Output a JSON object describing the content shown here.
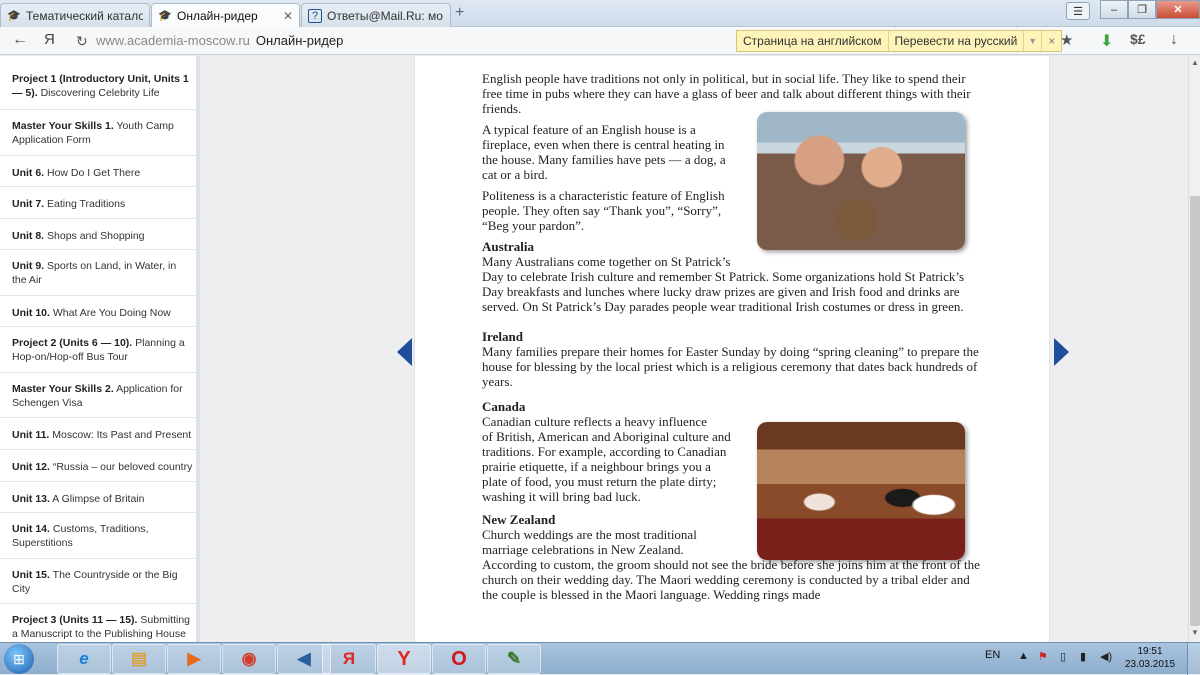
{
  "tabs": [
    {
      "title": "Тематический катало",
      "icon": "graduation-cap-icon",
      "active": false
    },
    {
      "title": "Онлайн-ридер",
      "icon": "graduation-cap-icon",
      "active": true
    },
    {
      "title": "Ответы@Mail.Ru: мо",
      "icon": "question-icon",
      "active": false
    }
  ],
  "address": {
    "back_icon": "←",
    "yandex_logo": "Я",
    "reload_icon": "↻",
    "domain": "www.academia-moscow.ru",
    "page_title": "Онлайн-ридер"
  },
  "translate": {
    "source": "Страница на английском",
    "action": "Перевести на русский",
    "close": "×"
  },
  "toolbar_right": {
    "star": "★",
    "download": "⬇",
    "currency": "$£",
    "save": "↓"
  },
  "sidebar": {
    "items": [
      {
        "unit": "Project 1 (Introductory Unit, Units 1 — 5).",
        "title": " Discovering Celebrity Life"
      },
      {
        "unit": "Master Your Skills 1.",
        "title": " Youth Camp Application Form"
      },
      {
        "unit": "Unit 6.",
        "title": " How Do I Get There"
      },
      {
        "unit": "Unit 7.",
        "title": " Eating Traditions"
      },
      {
        "unit": "Unit 8.",
        "title": " Shops and Shopping"
      },
      {
        "unit": "Unit 9.",
        "title": " Sports on Land, in Water, in the Air"
      },
      {
        "unit": "Unit 10.",
        "title": " What Are You Doing Now"
      },
      {
        "unit": "Project 2 (Units 6 — 10).",
        "title": " Planning a Hop-on/Hop-off Bus Tour"
      },
      {
        "unit": "Master Your Skills 2.",
        "title": " Application for Schengen Visa"
      },
      {
        "unit": "Unit 11.",
        "title": " Moscow: Its Past and Present"
      },
      {
        "unit": "Unit 12.",
        "title": " “Russia – our beloved country"
      },
      {
        "unit": "Unit 13.",
        "title": " A Glimpse of Britain"
      },
      {
        "unit": "Unit 14.",
        "title": " Customs, Traditions, Superstitions"
      },
      {
        "unit": "Unit 15.",
        "title": " The Countryside or the Big City"
      },
      {
        "unit": "Project 3 (Units 11 — 15).",
        "title": " Submitting a Manuscript to the Publishing House"
      }
    ]
  },
  "reader": {
    "p_england_social": "English people have traditions not only in political, but in social life. They like to spend their free time in pubs where they can have a glass of beer and talk about different things with their friends.",
    "p_house_1": "A typical feature of an English house is a",
    "p_house_2": "fireplace, even when there is central heating in",
    "p_house_3": "the house. Many families have pets — a dog, a",
    "p_house_4": "cat or a bird.",
    "p_polite_1": "Politeness is a characteristic feature of English",
    "p_polite_2": "people. They often say “Thank you”, “Sorry”,",
    "p_polite_3": "“Beg your pardon”.",
    "h_australia": "Australia",
    "p_australia_1": "Many Australians come together on St Patrick’s",
    "p_australia_2": "Day to celebrate Irish culture and remember St Patrick. Some organizations hold St Patrick’s Day breakfasts and lunches where lucky draw prizes are given and Irish food and drinks are served. On St Patrick’s Day parades people wear traditional Irish costumes or dress in green.",
    "h_ireland": "Ireland",
    "p_ireland": "Many families prepare their homes for Easter Sunday by doing “spring cleaning” to prepare the house for blessing by the local priest which is a religious ceremony that dates back hundreds of years.",
    "h_canada": "Canada",
    "p_canada_1": "Canadian culture reflects a heavy influence",
    "p_canada_2": "of British, American and Aboriginal culture and",
    "p_canada_3": "traditions. For example, according to Canadian",
    "p_canada_4": "prairie etiquette, if a neighbour brings you a",
    "p_canada_5": "plate of food, you must return the plate dirty;",
    "p_canada_6": "washing it will bring bad luck.",
    "h_nz": "New Zealand",
    "p_nz_1": "Church weddings are the most traditional",
    "p_nz_2": "marriage celebrations in New Zealand.",
    "p_nz_3": "According to custom, the groom should not see the bride before she joins him at the front of the church on their wedding day. The Maori wedding ceremony is conducted by a tribal elder and the couple is blessed in the Maori language. Wedding rings made"
  },
  "taskbar": {
    "apps": [
      {
        "name": "ie",
        "glyph": "e",
        "color": "#1a7fd6"
      },
      {
        "name": "explorer",
        "glyph": "▤",
        "color": "#d8a43a"
      },
      {
        "name": "media",
        "glyph": "▶",
        "color": "#e86a1c"
      },
      {
        "name": "chrome",
        "glyph": "◉",
        "color": "#d33b2b"
      },
      {
        "name": "speaker",
        "glyph": "◀",
        "color": "#2a5f9e"
      },
      {
        "name": "yandex-disk",
        "glyph": "Я",
        "color": "#e3261f"
      },
      {
        "name": "yandex-browser",
        "glyph": "Y",
        "color": "#e3261f"
      },
      {
        "name": "opera",
        "glyph": "O",
        "color": "#d0171b"
      },
      {
        "name": "paint",
        "glyph": "✎",
        "color": "#3a7a2a"
      }
    ],
    "lang": "EN",
    "time": "19:51",
    "date": "23.03.2015"
  }
}
